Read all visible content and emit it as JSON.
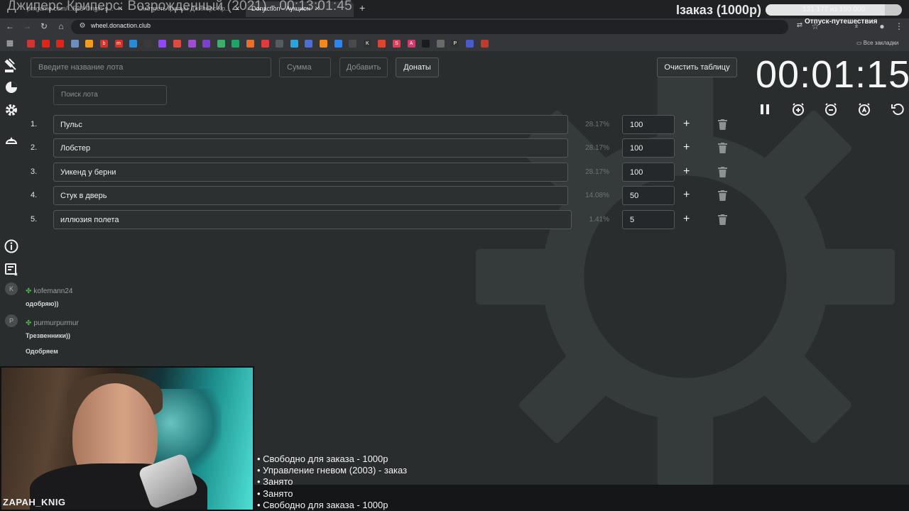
{
  "overlay": {
    "stream_title": "Джиперс Криперс: Возрожденный (2021) - 00:13:01:45",
    "order_badge": "Iзаказ (1000р)",
    "progress_text": "131 177 из 150 000",
    "progress_fraction": 0.874,
    "extension_label": "Отпуск-путешествия"
  },
  "browser": {
    "tabs": [
      {
        "label": "pmgame.com/...523-Origin-s...",
        "active": false
      },
      {
        "label": "Смотреть фильм Джиперс Кр...",
        "active": false
      },
      {
        "label": "Donaction - Аукцион",
        "active": true
      }
    ],
    "url": "wheel.donaction.club",
    "all_bookmarks": "Все закладки",
    "bookmarks": [
      {
        "icon": "tile",
        "color": "#d0352f",
        "label": ""
      },
      {
        "icon": "youtube-icon",
        "color": "#e62117",
        "label": ""
      },
      {
        "icon": "youtube-icon",
        "color": "#e62117",
        "label": ""
      },
      {
        "icon": "app-icon",
        "color": "#6c8ebf",
        "label": ""
      },
      {
        "icon": "mail-icon",
        "color": "#f29b1d",
        "label": ""
      },
      {
        "icon": "gmail-icon",
        "color": "#d93025",
        "label": "b"
      },
      {
        "icon": "gmail-icon",
        "color": "#d93025",
        "label": "m"
      },
      {
        "icon": "edge-icon",
        "color": "#2a8bd5",
        "label": ""
      },
      {
        "icon": "plus-icon",
        "color": "#3a3a3a",
        "label": ""
      },
      {
        "icon": "twitch-icon",
        "color": "#9146ff",
        "label": ""
      },
      {
        "icon": "app-icon",
        "color": "#e04a3a",
        "label": ""
      },
      {
        "icon": "ring-icon",
        "color": "#a04bd9",
        "label": ""
      },
      {
        "icon": "wc-icon",
        "color": "#7b3fd6",
        "label": ""
      },
      {
        "icon": "app-icon",
        "color": "#3ab06a",
        "label": ""
      },
      {
        "icon": "sheet-icon",
        "color": "#1fa463",
        "label": ""
      },
      {
        "icon": "app-icon",
        "color": "#f06a2a",
        "label": ""
      },
      {
        "icon": "app-icon",
        "color": "#e23b3b",
        "label": ""
      },
      {
        "icon": "app-icon",
        "color": "#555c61",
        "label": ""
      },
      {
        "icon": "app-icon",
        "color": "#2aa4e0",
        "label": ""
      },
      {
        "icon": "app-icon",
        "color": "#4a6fd6",
        "label": ""
      },
      {
        "icon": "ok-icon",
        "color": "#f08a18",
        "label": ""
      },
      {
        "icon": "vk-icon",
        "color": "#2787f5",
        "label": ""
      },
      {
        "icon": "app-icon",
        "color": "#4a4a4a",
        "label": ""
      },
      {
        "icon": "k-icon",
        "color": "#303030",
        "label": "K"
      },
      {
        "icon": "app-icon",
        "color": "#e0442f",
        "label": ""
      },
      {
        "icon": "s-icon",
        "color": "#e03c5a",
        "label": "S"
      },
      {
        "icon": "a-icon",
        "color": "#d23b6a",
        "label": "A"
      },
      {
        "icon": "play-icon",
        "color": "#1b1b1b",
        "label": ""
      },
      {
        "icon": "app-icon",
        "color": "#6a6a6a",
        "label": ""
      },
      {
        "icon": "p-icon",
        "color": "#303030",
        "label": "P"
      },
      {
        "icon": "app-icon",
        "color": "#4a5ac8",
        "label": ""
      },
      {
        "icon": "app-icon",
        "color": "#c23a2a",
        "label": ""
      }
    ]
  },
  "toolbar": {
    "lot_name_placeholder": "Введите название лота",
    "amount_placeholder": "Сумма",
    "add_label": "Добавить",
    "donations_label": "Донаты",
    "clear_label": "Очистить таблицу",
    "search_placeholder": "Поиск лота"
  },
  "lots": [
    {
      "num": "1.",
      "name": "Пульс",
      "percent": "28.17%",
      "amount": "100"
    },
    {
      "num": "2.",
      "name": "Лобстер",
      "percent": "28.17%",
      "amount": "100"
    },
    {
      "num": "3.",
      "name": "Уикенд у берни",
      "percent": "28.17%",
      "amount": "100"
    },
    {
      "num": "4.",
      "name": "Стук в дверь",
      "percent": "14.08%",
      "amount": "50"
    },
    {
      "num": "5.",
      "name": "иллюзия полета",
      "percent": "1.41%",
      "amount": "5"
    }
  ],
  "timer": {
    "display": "00:01:15"
  },
  "chat": [
    {
      "avatar": "K",
      "user": "kofemann24",
      "message": "одобряю))"
    },
    {
      "avatar": "P",
      "user": "purmurpurmur",
      "message": "Трезвенники))"
    },
    {
      "avatar": "",
      "user": "",
      "message": "Одобряем"
    }
  ],
  "webcam": {
    "name": "ZAPAH_KNIG"
  },
  "ticker": [
    "• Свободно для заказа - 1000р",
    "• Управление гневом (2003) - заказ",
    "• Занято",
    "• Занято",
    "• Свободно для заказа - 1000р"
  ]
}
